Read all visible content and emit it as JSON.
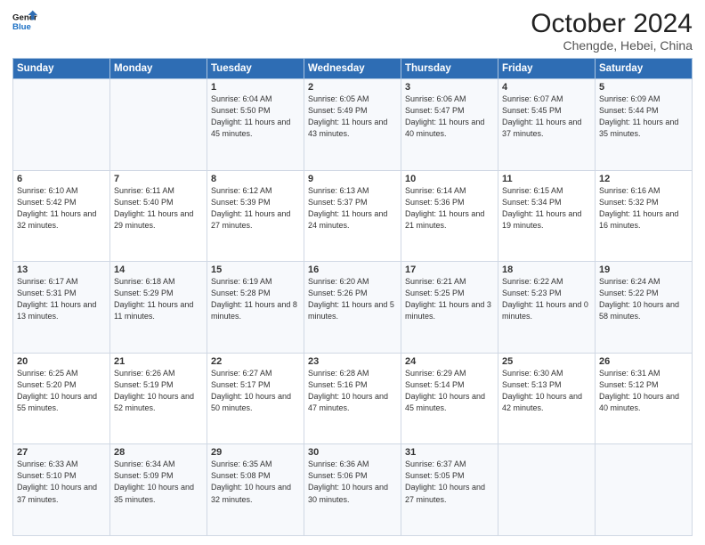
{
  "header": {
    "logo_line1": "General",
    "logo_line2": "Blue",
    "main_title": "October 2024",
    "subtitle": "Chengde, Hebei, China"
  },
  "weekdays": [
    "Sunday",
    "Monday",
    "Tuesday",
    "Wednesday",
    "Thursday",
    "Friday",
    "Saturday"
  ],
  "weeks": [
    [
      {
        "day": "",
        "info": ""
      },
      {
        "day": "",
        "info": ""
      },
      {
        "day": "1",
        "info": "Sunrise: 6:04 AM\nSunset: 5:50 PM\nDaylight: 11 hours and 45 minutes."
      },
      {
        "day": "2",
        "info": "Sunrise: 6:05 AM\nSunset: 5:49 PM\nDaylight: 11 hours and 43 minutes."
      },
      {
        "day": "3",
        "info": "Sunrise: 6:06 AM\nSunset: 5:47 PM\nDaylight: 11 hours and 40 minutes."
      },
      {
        "day": "4",
        "info": "Sunrise: 6:07 AM\nSunset: 5:45 PM\nDaylight: 11 hours and 37 minutes."
      },
      {
        "day": "5",
        "info": "Sunrise: 6:09 AM\nSunset: 5:44 PM\nDaylight: 11 hours and 35 minutes."
      }
    ],
    [
      {
        "day": "6",
        "info": "Sunrise: 6:10 AM\nSunset: 5:42 PM\nDaylight: 11 hours and 32 minutes."
      },
      {
        "day": "7",
        "info": "Sunrise: 6:11 AM\nSunset: 5:40 PM\nDaylight: 11 hours and 29 minutes."
      },
      {
        "day": "8",
        "info": "Sunrise: 6:12 AM\nSunset: 5:39 PM\nDaylight: 11 hours and 27 minutes."
      },
      {
        "day": "9",
        "info": "Sunrise: 6:13 AM\nSunset: 5:37 PM\nDaylight: 11 hours and 24 minutes."
      },
      {
        "day": "10",
        "info": "Sunrise: 6:14 AM\nSunset: 5:36 PM\nDaylight: 11 hours and 21 minutes."
      },
      {
        "day": "11",
        "info": "Sunrise: 6:15 AM\nSunset: 5:34 PM\nDaylight: 11 hours and 19 minutes."
      },
      {
        "day": "12",
        "info": "Sunrise: 6:16 AM\nSunset: 5:32 PM\nDaylight: 11 hours and 16 minutes."
      }
    ],
    [
      {
        "day": "13",
        "info": "Sunrise: 6:17 AM\nSunset: 5:31 PM\nDaylight: 11 hours and 13 minutes."
      },
      {
        "day": "14",
        "info": "Sunrise: 6:18 AM\nSunset: 5:29 PM\nDaylight: 11 hours and 11 minutes."
      },
      {
        "day": "15",
        "info": "Sunrise: 6:19 AM\nSunset: 5:28 PM\nDaylight: 11 hours and 8 minutes."
      },
      {
        "day": "16",
        "info": "Sunrise: 6:20 AM\nSunset: 5:26 PM\nDaylight: 11 hours and 5 minutes."
      },
      {
        "day": "17",
        "info": "Sunrise: 6:21 AM\nSunset: 5:25 PM\nDaylight: 11 hours and 3 minutes."
      },
      {
        "day": "18",
        "info": "Sunrise: 6:22 AM\nSunset: 5:23 PM\nDaylight: 11 hours and 0 minutes."
      },
      {
        "day": "19",
        "info": "Sunrise: 6:24 AM\nSunset: 5:22 PM\nDaylight: 10 hours and 58 minutes."
      }
    ],
    [
      {
        "day": "20",
        "info": "Sunrise: 6:25 AM\nSunset: 5:20 PM\nDaylight: 10 hours and 55 minutes."
      },
      {
        "day": "21",
        "info": "Sunrise: 6:26 AM\nSunset: 5:19 PM\nDaylight: 10 hours and 52 minutes."
      },
      {
        "day": "22",
        "info": "Sunrise: 6:27 AM\nSunset: 5:17 PM\nDaylight: 10 hours and 50 minutes."
      },
      {
        "day": "23",
        "info": "Sunrise: 6:28 AM\nSunset: 5:16 PM\nDaylight: 10 hours and 47 minutes."
      },
      {
        "day": "24",
        "info": "Sunrise: 6:29 AM\nSunset: 5:14 PM\nDaylight: 10 hours and 45 minutes."
      },
      {
        "day": "25",
        "info": "Sunrise: 6:30 AM\nSunset: 5:13 PM\nDaylight: 10 hours and 42 minutes."
      },
      {
        "day": "26",
        "info": "Sunrise: 6:31 AM\nSunset: 5:12 PM\nDaylight: 10 hours and 40 minutes."
      }
    ],
    [
      {
        "day": "27",
        "info": "Sunrise: 6:33 AM\nSunset: 5:10 PM\nDaylight: 10 hours and 37 minutes."
      },
      {
        "day": "28",
        "info": "Sunrise: 6:34 AM\nSunset: 5:09 PM\nDaylight: 10 hours and 35 minutes."
      },
      {
        "day": "29",
        "info": "Sunrise: 6:35 AM\nSunset: 5:08 PM\nDaylight: 10 hours and 32 minutes."
      },
      {
        "day": "30",
        "info": "Sunrise: 6:36 AM\nSunset: 5:06 PM\nDaylight: 10 hours and 30 minutes."
      },
      {
        "day": "31",
        "info": "Sunrise: 6:37 AM\nSunset: 5:05 PM\nDaylight: 10 hours and 27 minutes."
      },
      {
        "day": "",
        "info": ""
      },
      {
        "day": "",
        "info": ""
      }
    ]
  ]
}
